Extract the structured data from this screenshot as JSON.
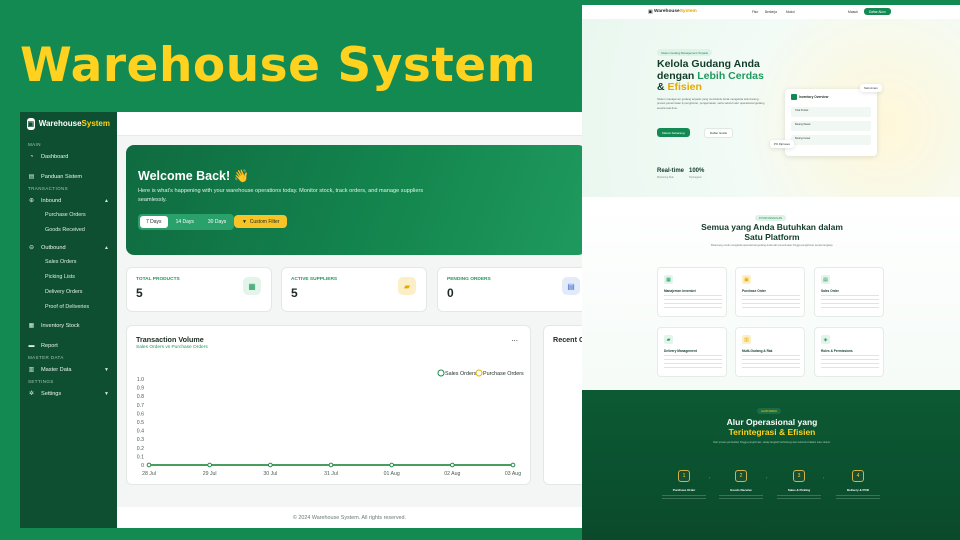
{
  "hero": {
    "title": "Warehouse System"
  },
  "dashboard": {
    "brand": {
      "part1": "Warehouse",
      "part2": "System"
    },
    "sidebar": {
      "sections": {
        "main": "MAIN",
        "transactions": "TRANSACTIONS",
        "master_data": "MASTER DATA",
        "settings": "SETTINGS"
      },
      "items": {
        "dashboard": "Dashboard",
        "panduan": "Panduan Sistem",
        "inbound": "Inbound",
        "purchase_orders": "Purchase Orders",
        "goods_received": "Goods Received",
        "outbound": "Outbound",
        "sales_orders": "Sales Orders",
        "picking_lists": "Picking Lists",
        "delivery_orders": "Delivery Orders",
        "proof_of_deliveries": "Proof of Deliveries",
        "inventory_stock": "Inventory Stock",
        "report": "Report",
        "master_data": "Master Data",
        "settings": "Settings"
      },
      "icons": {
        "dashboard": "dashboard-icon",
        "panduan": "book-icon",
        "inbound": "inbound-icon",
        "outbound": "outbound-icon",
        "inventory": "box-icon",
        "report": "folder-icon",
        "master_data": "database-icon",
        "settings": "gear-icon"
      }
    },
    "welcome": {
      "title": "Welcome Back! 👋",
      "text": "Here is what's happening with your warehouse operations today. Monitor stock, track orders, and manage suppliers seamlessly.",
      "ranges": [
        "7 Days",
        "14 Days",
        "30 Days"
      ],
      "active_range": "7 Days",
      "custom_filter": "Custom Filter"
    },
    "stats": [
      {
        "label": "TOTAL PRODUCTS",
        "value": "5",
        "icon": "boxes-icon",
        "color": "#1e9a5c"
      },
      {
        "label": "ACTIVE SUPPLIERS",
        "value": "5",
        "icon": "truck-icon",
        "color": "#e8a800"
      },
      {
        "label": "PENDING ORDERS",
        "value": "0",
        "icon": "document-icon",
        "color": "#3b6fd4"
      }
    ],
    "chart_card": {
      "title": "Transaction Volume",
      "subtitle": "Sales Orders vs Purchase Orders",
      "more": "...",
      "legend": [
        "Sales Orders",
        "Purchase Orders"
      ]
    },
    "recent_title": "Recent C",
    "footer": "© 2024 Warehouse System. All rights reserved."
  },
  "chart_data": {
    "type": "line",
    "title": "Transaction Volume",
    "subtitle": "Sales Orders vs Purchase Orders",
    "x": [
      "28 Jul",
      "29 Jul",
      "30 Jul",
      "31 Jul",
      "01 Aug",
      "02 Aug",
      "03 Aug"
    ],
    "series": [
      {
        "name": "Sales Orders",
        "values": [
          0,
          0,
          0,
          0,
          0,
          0,
          0
        ],
        "color": "#138a52"
      },
      {
        "name": "Purchase Orders",
        "values": [
          0,
          0,
          0,
          0,
          0,
          0,
          0
        ],
        "color": "#e8b400"
      }
    ],
    "yticks": [
      "1.0",
      "0.9",
      "0.8",
      "0.7",
      "0.6",
      "0.5",
      "0.4",
      "0.3",
      "0.2",
      "0.1",
      "0"
    ],
    "ylim": [
      0,
      1
    ],
    "legend_position": "top-right",
    "grid": false
  },
  "landing": {
    "nav": {
      "brand1": "Warehouse",
      "brand2": "System",
      "links": [
        "Fitur",
        "Berkerja",
        "Modul"
      ],
      "login": "Masuk",
      "register": "Daftar Akun"
    },
    "hero": {
      "badge": "Sistem Gudang Management Terpadu",
      "line1": "Kelola Gudang Anda",
      "line2a": "dengan ",
      "line2b": "Lebih Cerdas",
      "line3a": "& ",
      "line3b": "Efisien",
      "para": "Sistem manajemen gudang terpadu yang membantu Anda mengelola stok barang, proses penerimaan & pengiriman, pengemasan, serta seluruh alur operasional gudang secara real-time.",
      "btn_primary": "Masuk Sekarang",
      "btn_secondary": "Daftar Gratis",
      "stat1": "Real-time",
      "stat1_sub": "Monitoring Stok",
      "stat2": "100%",
      "stat2_sub": "Terintegrasi",
      "mock_title": "Inventory Overview",
      "mock_rows": [
        "Total Produk",
        "Barang Masuk",
        "Barang Keluar"
      ],
      "float1": "Stok Aman",
      "float2": "PO Diproses"
    },
    "features": {
      "badge": "FITUR UNGGULAN",
      "title": "Semua yang Anda Butuhkan dalam Satu Platform",
      "text": "Dirancang untuk mengelola operasional gudang Anda dari penerimaan hingga pengiriman secara lengkap.",
      "cards": [
        {
          "title": "Manajemen Inventori",
          "icon": "boxes-icon"
        },
        {
          "title": "Purchase Order",
          "icon": "cart-icon"
        },
        {
          "title": "Sales Order",
          "icon": "document-icon"
        },
        {
          "title": "Delivery Management",
          "icon": "truck-icon"
        },
        {
          "title": "Multi-Gudang & Rak",
          "icon": "warehouse-icon"
        },
        {
          "title": "Roles & Permissions",
          "icon": "shield-icon"
        }
      ]
    },
    "flow": {
      "badge": "ALUR KERJA",
      "title1": "Alur Operasional yang",
      "title2": "Terintegrasi & Efisien",
      "text": "Dari proses pembelian hingga pengiriman, setiap langkah terhubung dan terkontrol dalam satu sistem.",
      "steps": [
        {
          "num": "1",
          "title": "Purchase Order"
        },
        {
          "num": "2",
          "title": "Goods Receive"
        },
        {
          "num": "3",
          "title": "Sales & Picking"
        },
        {
          "num": "4",
          "title": "Delivery & POD"
        }
      ]
    }
  }
}
